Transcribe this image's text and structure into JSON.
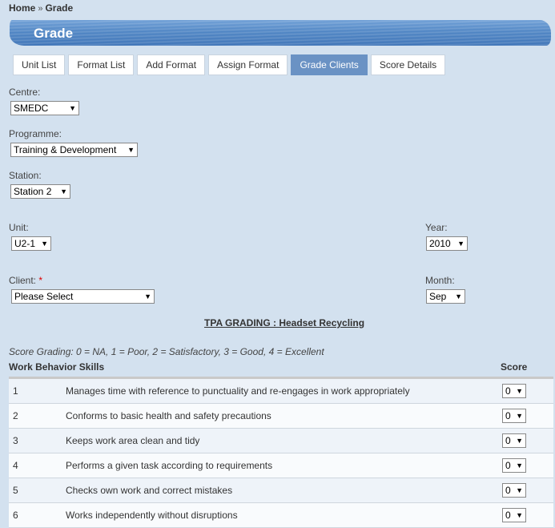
{
  "breadcrumb": {
    "home": "Home",
    "separator": "»",
    "current": "Grade"
  },
  "page": {
    "title": "Grade"
  },
  "tabs": [
    {
      "label": "Unit List",
      "active": false
    },
    {
      "label": "Format List",
      "active": false
    },
    {
      "label": "Add Format",
      "active": false
    },
    {
      "label": "Assign Format",
      "active": false
    },
    {
      "label": "Grade Clients",
      "active": true
    },
    {
      "label": "Score Details",
      "active": false
    }
  ],
  "form": {
    "centre": {
      "label": "Centre:",
      "value": "SMEDC"
    },
    "programme": {
      "label": "Programme:",
      "value": "Training & Development"
    },
    "station": {
      "label": "Station:",
      "value": "Station 2"
    },
    "unit": {
      "label": "Unit:",
      "value": "U2-1"
    },
    "year": {
      "label": "Year:",
      "value": "2010"
    },
    "client": {
      "label": "Client:",
      "required": "*",
      "value": "Please Select"
    },
    "month": {
      "label": "Month:",
      "value": "Sep"
    }
  },
  "grading": {
    "title": "TPA GRADING : Headset Recycling",
    "note": "Score Grading: 0 = NA, 1 = Poor, 2 = Satisfactory, 3 = Good, 4 = Excellent",
    "col_skills": "Work Behavior Skills",
    "col_score": "Score",
    "rows": [
      {
        "num": "1",
        "desc": "Manages time with reference to punctuality and re-engages in work appropriately",
        "score": "0"
      },
      {
        "num": "2",
        "desc": "Conforms to basic health and safety precautions",
        "score": "0"
      },
      {
        "num": "3",
        "desc": "Keeps work area clean and tidy",
        "score": "0"
      },
      {
        "num": "4",
        "desc": "Performs a given task according to requirements",
        "score": "0"
      },
      {
        "num": "5",
        "desc": "Checks own work and correct mistakes",
        "score": "0"
      },
      {
        "num": "6",
        "desc": "Works independently without disruptions",
        "score": "0"
      }
    ]
  },
  "colors": {
    "background": "#d3e1ef",
    "banner": "#4c83c3",
    "active_tab": "#6a92c4",
    "required": "#dd0000"
  },
  "icons": {
    "select_arrow": "▼"
  }
}
